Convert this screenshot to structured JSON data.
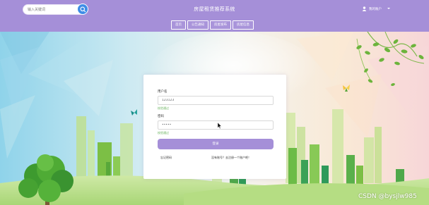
{
  "header": {
    "title": "房屋租赁推荐系统",
    "search": {
      "placeholder": "输入关键词",
      "value": ""
    },
    "user": {
      "label": "我的账户"
    }
  },
  "nav": {
    "items": [
      {
        "label": "首页"
      },
      {
        "label": "公告通知"
      },
      {
        "label": "房屋发布"
      },
      {
        "label": "房屋信息"
      }
    ]
  },
  "login": {
    "username_label": "用户名",
    "username_value": "123123",
    "username_hint": "校验通过",
    "password_label": "密码",
    "password_value": "•••••",
    "password_hint": "校验通过",
    "submit_label": "登录",
    "forgot_label": "忘记密码",
    "register_label": "没有账号？去注册一个账户吧！"
  },
  "colors": {
    "accent": "#a58fd8",
    "search_button": "#3f8de6",
    "hint_green": "#67b25c"
  },
  "icons": {
    "search": "magnifier",
    "user": "person",
    "dropdown": "caret-down"
  },
  "watermark": "CSDN @bysjlw985"
}
